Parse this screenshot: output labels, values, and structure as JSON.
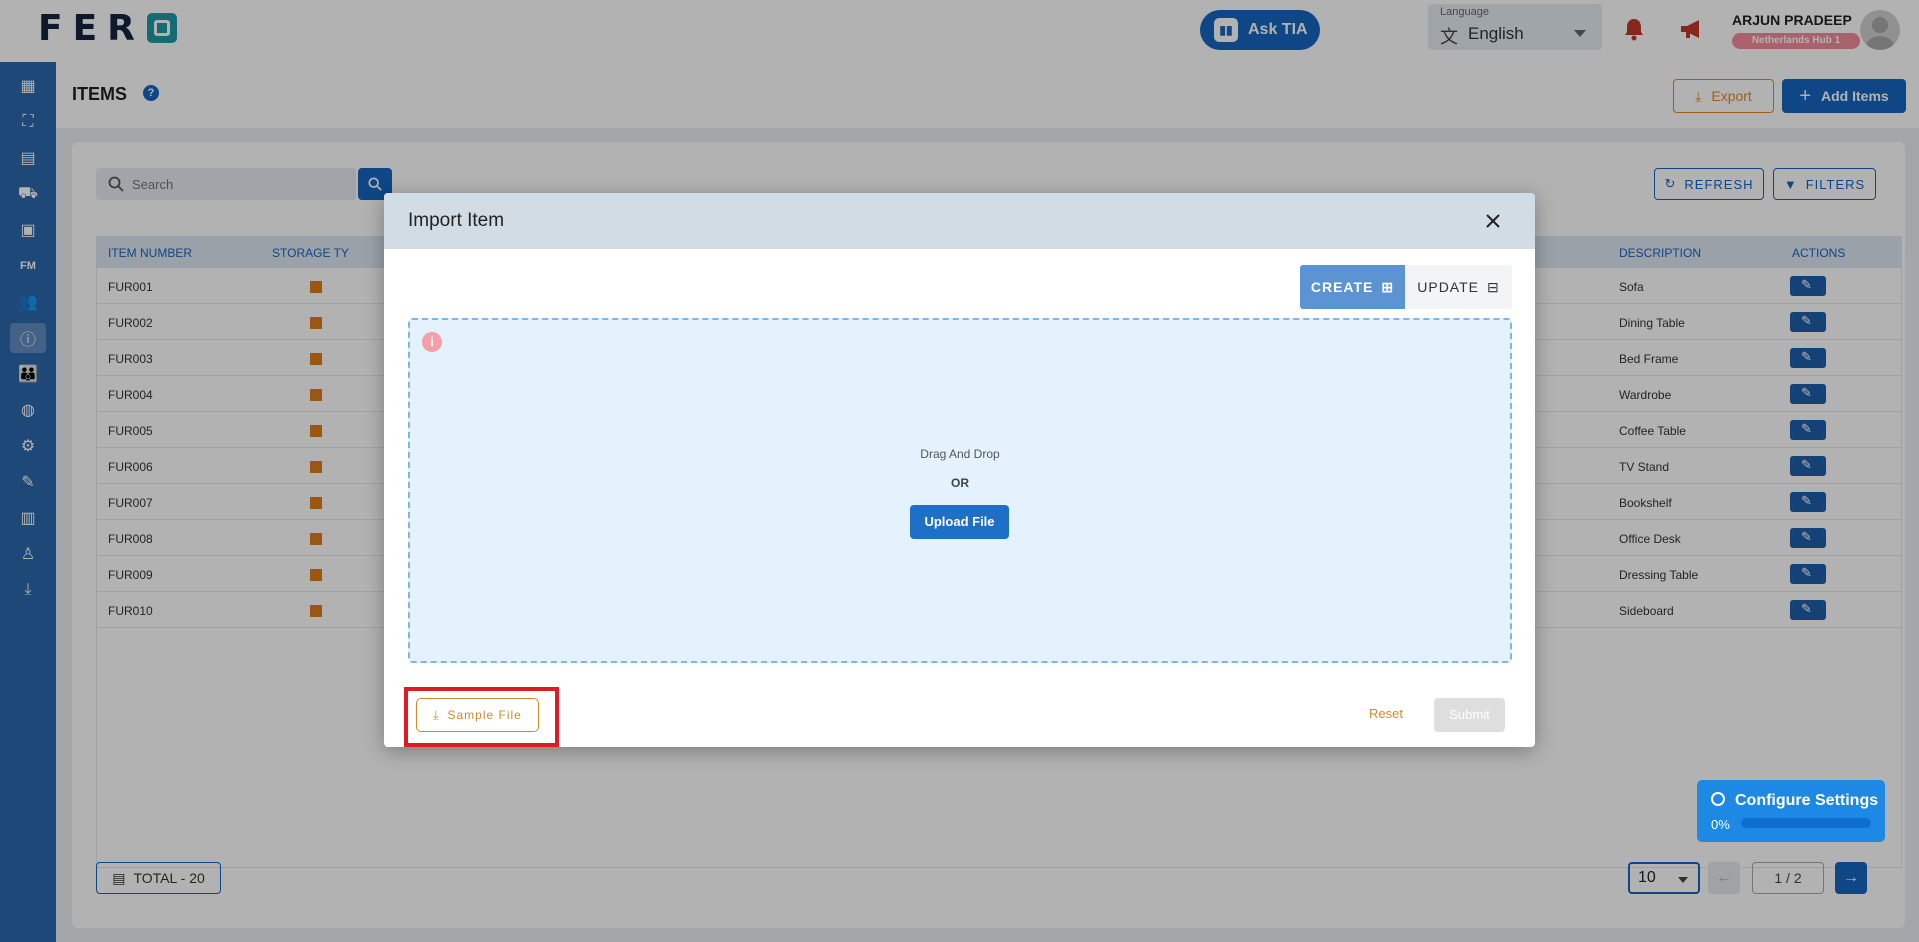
{
  "header": {
    "logo_text": "FER",
    "ask_tia_label": "Ask TIA",
    "language_label": "Language",
    "language_value": "English",
    "user_name": "ARJUN PRADEEP",
    "user_hub": "Netherlands Hub 1"
  },
  "sidebar": {
    "items": [
      {
        "icon": "dashboard-icon",
        "glyph": "▦"
      },
      {
        "icon": "chart-icon",
        "glyph": "⛶"
      },
      {
        "icon": "calendar-icon",
        "glyph": "▤"
      },
      {
        "icon": "truck-icon",
        "glyph": "⛟"
      },
      {
        "icon": "archive-icon",
        "glyph": "▣"
      },
      {
        "icon": "fm-icon",
        "glyph": "FM"
      },
      {
        "icon": "people-icon",
        "glyph": "👥"
      },
      {
        "icon": "info-icon",
        "glyph": "ⓘ"
      },
      {
        "icon": "group-icon",
        "glyph": "👪"
      },
      {
        "icon": "globe-icon",
        "glyph": "◍"
      },
      {
        "icon": "gear-icon",
        "glyph": "⚙"
      },
      {
        "icon": "edit-note-icon",
        "glyph": "✎"
      },
      {
        "icon": "clipboard-icon",
        "glyph": "▥"
      },
      {
        "icon": "user-tree-icon",
        "glyph": "♙"
      },
      {
        "icon": "download-icon",
        "glyph": "⤓"
      }
    ]
  },
  "page": {
    "title": "ITEMS",
    "export_label": "Export",
    "add_label": "Add Items"
  },
  "toolbar": {
    "search_placeholder": "Search",
    "refresh_label": "REFRESH",
    "filters_label": "FILTERS"
  },
  "table": {
    "columns": {
      "item_number": "ITEM NUMBER",
      "storage_type": "STORAGE TY",
      "description": "DESCRIPTION",
      "actions": "ACTIONS"
    },
    "rows": [
      {
        "item_number": "FUR001",
        "description": "Sofa"
      },
      {
        "item_number": "FUR002",
        "description": "Dining Table"
      },
      {
        "item_number": "FUR003",
        "description": "Bed Frame"
      },
      {
        "item_number": "FUR004",
        "description": "Wardrobe"
      },
      {
        "item_number": "FUR005",
        "description": "Coffee Table"
      },
      {
        "item_number": "FUR006",
        "description": "TV Stand"
      },
      {
        "item_number": "FUR007",
        "description": "Bookshelf"
      },
      {
        "item_number": "FUR008",
        "description": "Office Desk"
      },
      {
        "item_number": "FUR009",
        "description": "Dressing Table"
      },
      {
        "item_number": "FUR010",
        "description": "Sideboard"
      }
    ]
  },
  "footer": {
    "total_label": "TOTAL  - 20",
    "page_size": "10",
    "page_indicator": "1 / 2"
  },
  "modal": {
    "title": "Import Item",
    "create_label": "CREATE",
    "update_label": "UPDATE",
    "drag_text": "Drag And Drop",
    "or_text": "OR",
    "upload_label": "Upload File",
    "sample_label": "Sample File",
    "reset_label": "Reset",
    "submit_label": "Submit"
  },
  "configure": {
    "title": "Configure Settings",
    "progress_text": "0%",
    "progress_fraction": 0
  },
  "colors": {
    "primary": "#1565c0",
    "sidebar": "#2c67ad",
    "accent_orange": "#e08a1e",
    "highlight_red": "#e01b24"
  }
}
